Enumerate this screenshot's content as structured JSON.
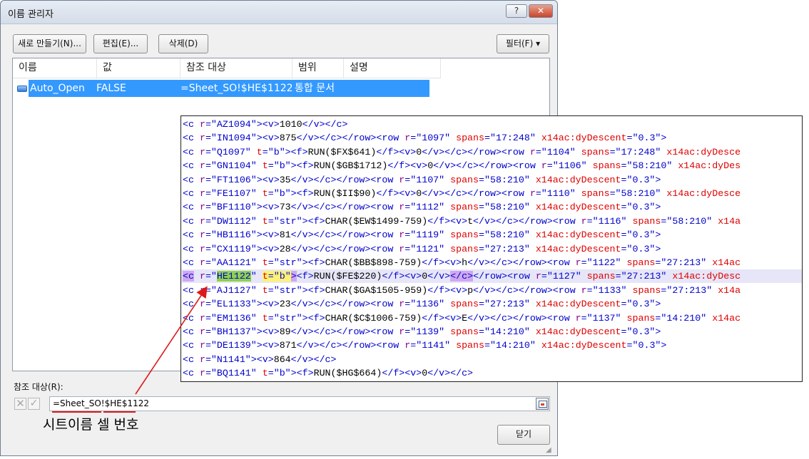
{
  "dialog": {
    "title": "이름 관리자",
    "help_label": "?",
    "close_label": "✕",
    "buttons": {
      "new": "새로 만들기(N)...",
      "edit": "편집(E)...",
      "delete": "삭제(D)",
      "filter": "필터(F) ▾",
      "close": "닫기"
    },
    "columns": [
      "이름",
      "값",
      "참조 대상",
      "범위",
      "설명"
    ],
    "rows": [
      {
        "name": "Auto_Open",
        "value": "FALSE",
        "refers_to": "=Sheet_SO!$HE$1122",
        "scope": "통합 문서",
        "comment": ""
      }
    ],
    "refers_to_label": "참조 대상(R):",
    "refers_to_value": "=Sheet_SO!$HE$1122",
    "icons": {
      "cancel": "x-icon",
      "confirm": "check-icon",
      "collapse": "range-select-icon",
      "name": "defined-name-icon"
    }
  },
  "annotation": {
    "text": "시트이름 셀 번호",
    "color": "#dd1a1a"
  },
  "xml_lines": [
    [
      [
        "b",
        "<c "
      ],
      [
        "p",
        "r"
      ],
      [
        "b",
        "="
      ],
      [
        "b",
        "\"AZ1094\""
      ],
      [
        "b",
        ">"
      ],
      [
        "b",
        "<v>"
      ],
      [
        "k",
        "1010"
      ],
      [
        "b",
        "</v></c>"
      ]
    ],
    [
      [
        "b",
        "<c "
      ],
      [
        "p",
        "r"
      ],
      [
        "b",
        "="
      ],
      [
        "b",
        "\"IN1094\""
      ],
      [
        "b",
        ">"
      ],
      [
        "b",
        "<v>"
      ],
      [
        "k",
        "875"
      ],
      [
        "b",
        "</v></c></row><row "
      ],
      [
        "p",
        "r"
      ],
      [
        "b",
        "="
      ],
      [
        "b",
        "\"1097\" "
      ],
      [
        "r",
        "spans"
      ],
      [
        "b",
        "="
      ],
      [
        "b",
        "\"17:248\" "
      ],
      [
        "r",
        "x14ac:dyDescent"
      ],
      [
        "b",
        "="
      ],
      [
        "b",
        "\"0.3\">"
      ]
    ],
    [
      [
        "b",
        "<c "
      ],
      [
        "p",
        "r"
      ],
      [
        "b",
        "="
      ],
      [
        "b",
        "\"Q1097\" "
      ],
      [
        "r",
        "t"
      ],
      [
        "b",
        "="
      ],
      [
        "b",
        "\"b\">"
      ],
      [
        "b",
        "<f>"
      ],
      [
        "k",
        "RUN($FX$641)"
      ],
      [
        "b",
        "</f><v>"
      ],
      [
        "k",
        "0"
      ],
      [
        "b",
        "</v></c></row><row "
      ],
      [
        "p",
        "r"
      ],
      [
        "b",
        "="
      ],
      [
        "b",
        "\"1104\" "
      ],
      [
        "r",
        "spans"
      ],
      [
        "b",
        "="
      ],
      [
        "b",
        "\"17:248\" "
      ],
      [
        "r",
        "x14ac:dyDesce"
      ]
    ],
    [
      [
        "b",
        "<c "
      ],
      [
        "p",
        "r"
      ],
      [
        "b",
        "="
      ],
      [
        "b",
        "\"GN1104\" "
      ],
      [
        "r",
        "t"
      ],
      [
        "b",
        "="
      ],
      [
        "b",
        "\"b\">"
      ],
      [
        "b",
        "<f>"
      ],
      [
        "k",
        "RUN($GB$1712)"
      ],
      [
        "b",
        "</f><v>"
      ],
      [
        "k",
        "0"
      ],
      [
        "b",
        "</v></c></row><row "
      ],
      [
        "p",
        "r"
      ],
      [
        "b",
        "="
      ],
      [
        "b",
        "\"1106\" "
      ],
      [
        "r",
        "spans"
      ],
      [
        "b",
        "="
      ],
      [
        "b",
        "\"58:210\" "
      ],
      [
        "r",
        "x14ac:dyDes"
      ]
    ],
    [
      [
        "b",
        "<c "
      ],
      [
        "p",
        "r"
      ],
      [
        "b",
        "="
      ],
      [
        "b",
        "\"FT1106\""
      ],
      [
        "b",
        ">"
      ],
      [
        "b",
        "<v>"
      ],
      [
        "k",
        "35"
      ],
      [
        "b",
        "</v></c></row><row "
      ],
      [
        "p",
        "r"
      ],
      [
        "b",
        "="
      ],
      [
        "b",
        "\"1107\" "
      ],
      [
        "r",
        "spans"
      ],
      [
        "b",
        "="
      ],
      [
        "b",
        "\"58:210\" "
      ],
      [
        "r",
        "x14ac:dyDescent"
      ],
      [
        "b",
        "="
      ],
      [
        "b",
        "\"0.3\">"
      ]
    ],
    [
      [
        "b",
        "<c "
      ],
      [
        "p",
        "r"
      ],
      [
        "b",
        "="
      ],
      [
        "b",
        "\"FE1107\" "
      ],
      [
        "r",
        "t"
      ],
      [
        "b",
        "="
      ],
      [
        "b",
        "\"b\">"
      ],
      [
        "b",
        "<f>"
      ],
      [
        "k",
        "RUN($II$90)"
      ],
      [
        "b",
        "</f><v>"
      ],
      [
        "k",
        "0"
      ],
      [
        "b",
        "</v></c></row><row "
      ],
      [
        "p",
        "r"
      ],
      [
        "b",
        "="
      ],
      [
        "b",
        "\"1110\" "
      ],
      [
        "r",
        "spans"
      ],
      [
        "b",
        "="
      ],
      [
        "b",
        "\"58:210\" "
      ],
      [
        "r",
        "x14ac:dyDesce"
      ]
    ],
    [
      [
        "b",
        "<c "
      ],
      [
        "p",
        "r"
      ],
      [
        "b",
        "="
      ],
      [
        "b",
        "\"BF1110\""
      ],
      [
        "b",
        ">"
      ],
      [
        "b",
        "<v>"
      ],
      [
        "k",
        "73"
      ],
      [
        "b",
        "</v></c></row><row "
      ],
      [
        "p",
        "r"
      ],
      [
        "b",
        "="
      ],
      [
        "b",
        "\"1112\" "
      ],
      [
        "r",
        "spans"
      ],
      [
        "b",
        "="
      ],
      [
        "b",
        "\"58:210\" "
      ],
      [
        "r",
        "x14ac:dyDescent"
      ],
      [
        "b",
        "="
      ],
      [
        "b",
        "\"0.3\">"
      ]
    ],
    [
      [
        "b",
        "<c "
      ],
      [
        "p",
        "r"
      ],
      [
        "b",
        "="
      ],
      [
        "b",
        "\"DW1112\" "
      ],
      [
        "r",
        "t"
      ],
      [
        "b",
        "="
      ],
      [
        "b",
        "\"str\">"
      ],
      [
        "b",
        "<f>"
      ],
      [
        "k",
        "CHAR($EW$1499-759)"
      ],
      [
        "b",
        "</f><v>"
      ],
      [
        "k",
        "t"
      ],
      [
        "b",
        "</v></c></row><row "
      ],
      [
        "p",
        "r"
      ],
      [
        "b",
        "="
      ],
      [
        "b",
        "\"1116\" "
      ],
      [
        "r",
        "spans"
      ],
      [
        "b",
        "="
      ],
      [
        "b",
        "\"58:210\" "
      ],
      [
        "r",
        "x14a"
      ]
    ],
    [
      [
        "b",
        "<c "
      ],
      [
        "p",
        "r"
      ],
      [
        "b",
        "="
      ],
      [
        "b",
        "\"HB1116\""
      ],
      [
        "b",
        ">"
      ],
      [
        "b",
        "<v>"
      ],
      [
        "k",
        "81"
      ],
      [
        "b",
        "</v></c></row><row "
      ],
      [
        "p",
        "r"
      ],
      [
        "b",
        "="
      ],
      [
        "b",
        "\"1119\" "
      ],
      [
        "r",
        "spans"
      ],
      [
        "b",
        "="
      ],
      [
        "b",
        "\"58:210\" "
      ],
      [
        "r",
        "x14ac:dyDescent"
      ],
      [
        "b",
        "="
      ],
      [
        "b",
        "\"0.3\">"
      ]
    ],
    [
      [
        "b",
        "<c "
      ],
      [
        "p",
        "r"
      ],
      [
        "b",
        "="
      ],
      [
        "b",
        "\"CX1119\""
      ],
      [
        "b",
        ">"
      ],
      [
        "b",
        "<v>"
      ],
      [
        "k",
        "28"
      ],
      [
        "b",
        "</v></c></row><row "
      ],
      [
        "p",
        "r"
      ],
      [
        "b",
        "="
      ],
      [
        "b",
        "\"1121\" "
      ],
      [
        "r",
        "spans"
      ],
      [
        "b",
        "="
      ],
      [
        "b",
        "\"27:213\" "
      ],
      [
        "r",
        "x14ac:dyDescent"
      ],
      [
        "b",
        "="
      ],
      [
        "b",
        "\"0.3\">"
      ]
    ],
    [
      [
        "b",
        "<c "
      ],
      [
        "p",
        "r"
      ],
      [
        "b",
        "="
      ],
      [
        "b",
        "\"AA1121\" "
      ],
      [
        "r",
        "t"
      ],
      [
        "b",
        "="
      ],
      [
        "b",
        "\"str\">"
      ],
      [
        "b",
        "<f>"
      ],
      [
        "k",
        "CHAR($BB$898-759)"
      ],
      [
        "b",
        "</f><v>"
      ],
      [
        "k",
        "h"
      ],
      [
        "b",
        "</v></c></row><row "
      ],
      [
        "p",
        "r"
      ],
      [
        "b",
        "="
      ],
      [
        "b",
        "\"1122\" "
      ],
      [
        "r",
        "spans"
      ],
      [
        "b",
        "="
      ],
      [
        "b",
        "\"27:213\" "
      ],
      [
        "r",
        "x14ac"
      ]
    ],
    [
      [
        "b hl-purple",
        "<c"
      ],
      [
        "b",
        " "
      ],
      [
        "p",
        "r"
      ],
      [
        "b",
        "=\""
      ],
      [
        "b hl-green",
        "HE1122"
      ],
      [
        "b",
        "\" "
      ],
      [
        "r hl-yellow",
        "t"
      ],
      [
        "b hl-yellow",
        "=\"b\""
      ],
      [
        "b hl-purple",
        ">"
      ],
      [
        "b",
        "<f>"
      ],
      [
        "k",
        "RUN($FE$220)"
      ],
      [
        "b",
        "</f><v>"
      ],
      [
        "k",
        "0"
      ],
      [
        "b",
        "</v>"
      ],
      [
        "b hl-purple",
        "</c>"
      ],
      [
        "b",
        "</row><row "
      ],
      [
        "p",
        "r"
      ],
      [
        "b",
        "="
      ],
      [
        "b",
        "\"1127\" "
      ],
      [
        "r",
        "spans"
      ],
      [
        "b",
        "="
      ],
      [
        "b",
        "\"27:213\" "
      ],
      [
        "r",
        "x14ac:dyDesc"
      ]
    ],
    [
      [
        "b",
        "<c "
      ],
      [
        "p",
        "r"
      ],
      [
        "b",
        "="
      ],
      [
        "b",
        "\"AJ1127\" "
      ],
      [
        "r",
        "t"
      ],
      [
        "b",
        "="
      ],
      [
        "b",
        "\"str\">"
      ],
      [
        "b",
        "<f>"
      ],
      [
        "k",
        "CHAR($GA$1505-959)"
      ],
      [
        "b",
        "</f><v>"
      ],
      [
        "k",
        "p"
      ],
      [
        "b",
        "</v></c></row><row "
      ],
      [
        "p",
        "r"
      ],
      [
        "b",
        "="
      ],
      [
        "b",
        "\"1133\" "
      ],
      [
        "r",
        "spans"
      ],
      [
        "b",
        "="
      ],
      [
        "b",
        "\"27:213\" "
      ],
      [
        "r",
        "x14a"
      ]
    ],
    [
      [
        "b",
        "<c "
      ],
      [
        "p",
        "r"
      ],
      [
        "b",
        "="
      ],
      [
        "b",
        "\"EL1133\""
      ],
      [
        "b",
        ">"
      ],
      [
        "b",
        "<v>"
      ],
      [
        "k",
        "23"
      ],
      [
        "b",
        "</v></c></row><row "
      ],
      [
        "p",
        "r"
      ],
      [
        "b",
        "="
      ],
      [
        "b",
        "\"1136\" "
      ],
      [
        "r",
        "spans"
      ],
      [
        "b",
        "="
      ],
      [
        "b",
        "\"27:213\" "
      ],
      [
        "r",
        "x14ac:dyDescent"
      ],
      [
        "b",
        "="
      ],
      [
        "b",
        "\"0.3\">"
      ]
    ],
    [
      [
        "b",
        "<c "
      ],
      [
        "p",
        "r"
      ],
      [
        "b",
        "="
      ],
      [
        "b",
        "\"EM1136\" "
      ],
      [
        "r",
        "t"
      ],
      [
        "b",
        "="
      ],
      [
        "b",
        "\"str\">"
      ],
      [
        "b",
        "<f>"
      ],
      [
        "k",
        "CHAR($C$1006-759)"
      ],
      [
        "b",
        "</f><v>"
      ],
      [
        "k",
        "E"
      ],
      [
        "b",
        "</v></c></row><row "
      ],
      [
        "p",
        "r"
      ],
      [
        "b",
        "="
      ],
      [
        "b",
        "\"1137\" "
      ],
      [
        "r",
        "spans"
      ],
      [
        "b",
        "="
      ],
      [
        "b",
        "\"14:210\" "
      ],
      [
        "r",
        "x14ac"
      ]
    ],
    [
      [
        "b",
        "<c "
      ],
      [
        "p",
        "r"
      ],
      [
        "b",
        "="
      ],
      [
        "b",
        "\"BH1137\""
      ],
      [
        "b",
        ">"
      ],
      [
        "b",
        "<v>"
      ],
      [
        "k",
        "89"
      ],
      [
        "b",
        "</v></c></row><row "
      ],
      [
        "p",
        "r"
      ],
      [
        "b",
        "="
      ],
      [
        "b",
        "\"1139\" "
      ],
      [
        "r",
        "spans"
      ],
      [
        "b",
        "="
      ],
      [
        "b",
        "\"14:210\" "
      ],
      [
        "r",
        "x14ac:dyDescent"
      ],
      [
        "b",
        "="
      ],
      [
        "b",
        "\"0.3\">"
      ]
    ],
    [
      [
        "b",
        "<c "
      ],
      [
        "p",
        "r"
      ],
      [
        "b",
        "="
      ],
      [
        "b",
        "\"DE1139\""
      ],
      [
        "b",
        ">"
      ],
      [
        "b",
        "<v>"
      ],
      [
        "k",
        "871"
      ],
      [
        "b",
        "</v></c></row><row "
      ],
      [
        "p",
        "r"
      ],
      [
        "b",
        "="
      ],
      [
        "b",
        "\"1141\" "
      ],
      [
        "r",
        "spans"
      ],
      [
        "b",
        "="
      ],
      [
        "b",
        "\"14:210\" "
      ],
      [
        "r",
        "x14ac:dyDescent"
      ],
      [
        "b",
        "="
      ],
      [
        "b",
        "\"0.3\">"
      ]
    ],
    [
      [
        "b",
        "<c "
      ],
      [
        "p",
        "r"
      ],
      [
        "b",
        "="
      ],
      [
        "b",
        "\"N1141\""
      ],
      [
        "b",
        ">"
      ],
      [
        "b",
        "<v>"
      ],
      [
        "k",
        "864"
      ],
      [
        "b",
        "</v></c>"
      ]
    ],
    [
      [
        "b",
        "<c "
      ],
      [
        "p",
        "r"
      ],
      [
        "b",
        "="
      ],
      [
        "b",
        "\"BQ1141\" "
      ],
      [
        "r",
        "t"
      ],
      [
        "b",
        "="
      ],
      [
        "b",
        "\"b\">"
      ],
      [
        "b",
        "<f>"
      ],
      [
        "k",
        "RUN($HG$664)"
      ],
      [
        "b",
        "</f><v>"
      ],
      [
        "k",
        "0"
      ],
      [
        "b",
        "</v></c>"
      ]
    ]
  ],
  "highlighted_line_index": 11
}
